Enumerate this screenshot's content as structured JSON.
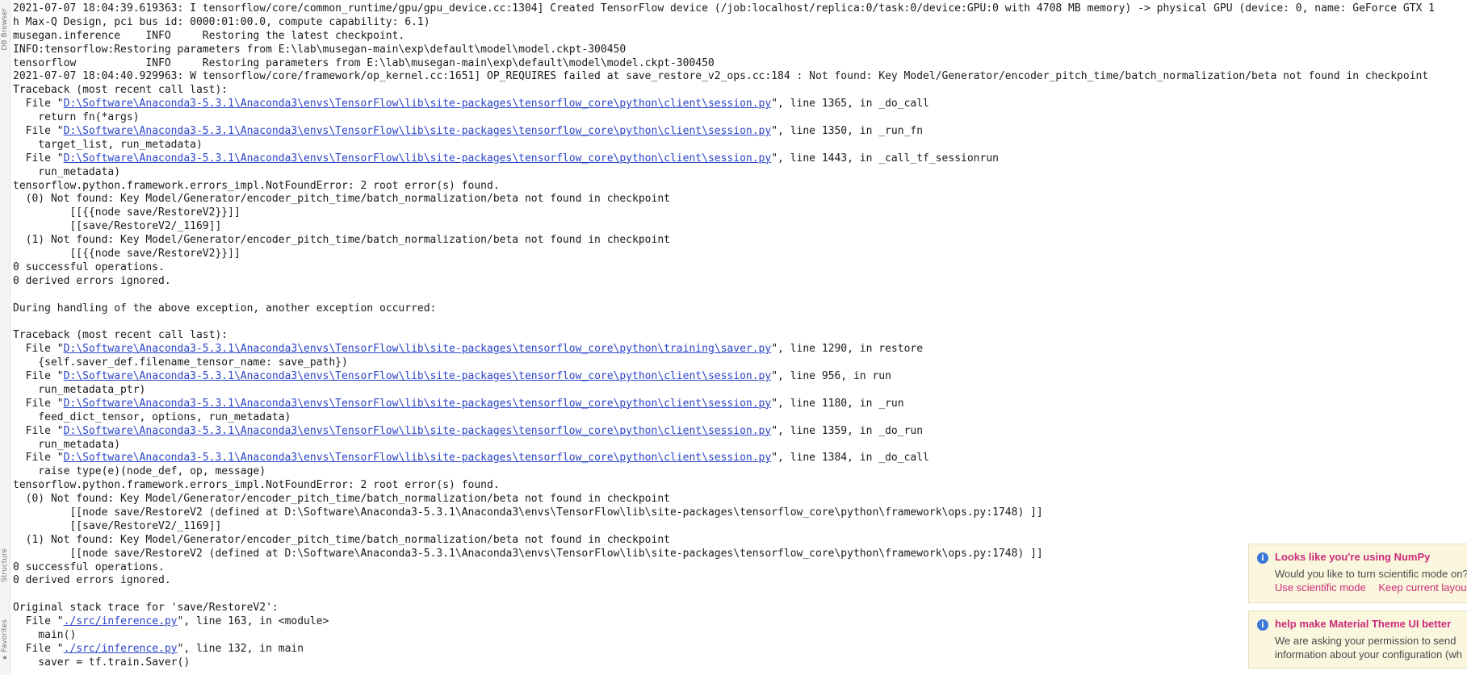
{
  "sidebar": {
    "top_tab": "DB Browser",
    "middle_tab": "Structure",
    "bottom_tab": "Favorites"
  },
  "console": {
    "lines": [
      {
        "t": "2021-07-07 18:04:39.619363: I tensorflow/core/common_runtime/gpu/gpu_device.cc:1304] Created TensorFlow device (/job:localhost/replica:0/task:0/device:GPU:0 with 4708 MB memory) -> physical GPU (device: 0, name: GeForce GTX 1"
      },
      {
        "t": "h Max-Q Design, pci bus id: 0000:01:00.0, compute capability: 6.1)"
      },
      {
        "t": "musegan.inference    INFO     Restoring the latest checkpoint."
      },
      {
        "t": "INFO:tensorflow:Restoring parameters from E:\\lab\\musegan-main\\exp\\default\\model\\model.ckpt-300450"
      },
      {
        "t": "tensorflow           INFO     Restoring parameters from E:\\lab\\musegan-main\\exp\\default\\model\\model.ckpt-300450"
      },
      {
        "t": "2021-07-07 18:04:40.929963: W tensorflow/core/framework/op_kernel.cc:1651] OP_REQUIRES failed at save_restore_v2_ops.cc:184 : Not found: Key Model/Generator/encoder_pitch_time/batch_normalization/beta not found in checkpoint"
      },
      {
        "t": "Traceback (most recent call last):"
      },
      {
        "pre": "  File \"",
        "link": "D:\\Software\\Anaconda3-5.3.1\\Anaconda3\\envs\\TensorFlow\\lib\\site-packages\\tensorflow_core\\python\\client\\session.py",
        "post": "\", line 1365, in _do_call"
      },
      {
        "t": "    return fn(*args)"
      },
      {
        "pre": "  File \"",
        "link": "D:\\Software\\Anaconda3-5.3.1\\Anaconda3\\envs\\TensorFlow\\lib\\site-packages\\tensorflow_core\\python\\client\\session.py",
        "post": "\", line 1350, in _run_fn"
      },
      {
        "t": "    target_list, run_metadata)"
      },
      {
        "pre": "  File \"",
        "link": "D:\\Software\\Anaconda3-5.3.1\\Anaconda3\\envs\\TensorFlow\\lib\\site-packages\\tensorflow_core\\python\\client\\session.py",
        "post": "\", line 1443, in _call_tf_sessionrun"
      },
      {
        "t": "    run_metadata)"
      },
      {
        "t": "tensorflow.python.framework.errors_impl.NotFoundError: 2 root error(s) found."
      },
      {
        "t": "  (0) Not found: Key Model/Generator/encoder_pitch_time/batch_normalization/beta not found in checkpoint"
      },
      {
        "t": "\t [[{{node save/RestoreV2}}]]"
      },
      {
        "t": "\t [[save/RestoreV2/_1169]]"
      },
      {
        "t": "  (1) Not found: Key Model/Generator/encoder_pitch_time/batch_normalization/beta not found in checkpoint"
      },
      {
        "t": "\t [[{{node save/RestoreV2}}]]"
      },
      {
        "t": "0 successful operations."
      },
      {
        "t": "0 derived errors ignored."
      },
      {
        "t": ""
      },
      {
        "t": "During handling of the above exception, another exception occurred:"
      },
      {
        "t": ""
      },
      {
        "t": "Traceback (most recent call last):"
      },
      {
        "pre": "  File \"",
        "link": "D:\\Software\\Anaconda3-5.3.1\\Anaconda3\\envs\\TensorFlow\\lib\\site-packages\\tensorflow_core\\python\\training\\saver.py",
        "post": "\", line 1290, in restore"
      },
      {
        "t": "    {self.saver_def.filename_tensor_name: save_path})"
      },
      {
        "pre": "  File \"",
        "link": "D:\\Software\\Anaconda3-5.3.1\\Anaconda3\\envs\\TensorFlow\\lib\\site-packages\\tensorflow_core\\python\\client\\session.py",
        "post": "\", line 956, in run"
      },
      {
        "t": "    run_metadata_ptr)"
      },
      {
        "pre": "  File \"",
        "link": "D:\\Software\\Anaconda3-5.3.1\\Anaconda3\\envs\\TensorFlow\\lib\\site-packages\\tensorflow_core\\python\\client\\session.py",
        "post": "\", line 1180, in _run"
      },
      {
        "t": "    feed_dict_tensor, options, run_metadata)"
      },
      {
        "pre": "  File \"",
        "link": "D:\\Software\\Anaconda3-5.3.1\\Anaconda3\\envs\\TensorFlow\\lib\\site-packages\\tensorflow_core\\python\\client\\session.py",
        "post": "\", line 1359, in _do_run"
      },
      {
        "t": "    run_metadata)"
      },
      {
        "pre": "  File \"",
        "link": "D:\\Software\\Anaconda3-5.3.1\\Anaconda3\\envs\\TensorFlow\\lib\\site-packages\\tensorflow_core\\python\\client\\session.py",
        "post": "\", line 1384, in _do_call"
      },
      {
        "t": "    raise type(e)(node_def, op, message)"
      },
      {
        "t": "tensorflow.python.framework.errors_impl.NotFoundError: 2 root error(s) found."
      },
      {
        "t": "  (0) Not found: Key Model/Generator/encoder_pitch_time/batch_normalization/beta not found in checkpoint"
      },
      {
        "t": "\t [[node save/RestoreV2 (defined at D:\\Software\\Anaconda3-5.3.1\\Anaconda3\\envs\\TensorFlow\\lib\\site-packages\\tensorflow_core\\python\\framework\\ops.py:1748) ]]"
      },
      {
        "t": "\t [[save/RestoreV2/_1169]]"
      },
      {
        "t": "  (1) Not found: Key Model/Generator/encoder_pitch_time/batch_normalization/beta not found in checkpoint"
      },
      {
        "t": "\t [[node save/RestoreV2 (defined at D:\\Software\\Anaconda3-5.3.1\\Anaconda3\\envs\\TensorFlow\\lib\\site-packages\\tensorflow_core\\python\\framework\\ops.py:1748) ]]"
      },
      {
        "t": "0 successful operations."
      },
      {
        "t": "0 derived errors ignored."
      },
      {
        "t": ""
      },
      {
        "t": "Original stack trace for 'save/RestoreV2':"
      },
      {
        "pre": "  File \"",
        "link": "./src/inference.py",
        "post": "\", line 163, in <module>"
      },
      {
        "t": "    main()"
      },
      {
        "pre": "  File \"",
        "link": "./src/inference.py",
        "post": "\", line 132, in main"
      },
      {
        "t": "    saver = tf.train.Saver()"
      }
    ]
  },
  "notifications": [
    {
      "title": "Looks like you're using NumPy",
      "body": [
        "Would you like to turn scientific mode on?"
      ],
      "actions": [
        "Use scientific mode",
        "Keep current layout"
      ]
    },
    {
      "title": "help make Material Theme UI better",
      "body": [
        "We are asking your permission to send",
        "information about your configuration (wh"
      ],
      "actions": []
    }
  ],
  "colors": {
    "link": "#2a44c8",
    "notif_title": "#cc2a78",
    "notif_bg": "#fbf7de",
    "info_icon": "#3b78d8"
  },
  "icons": {
    "notification": "info-icon",
    "side": "star-icon"
  }
}
